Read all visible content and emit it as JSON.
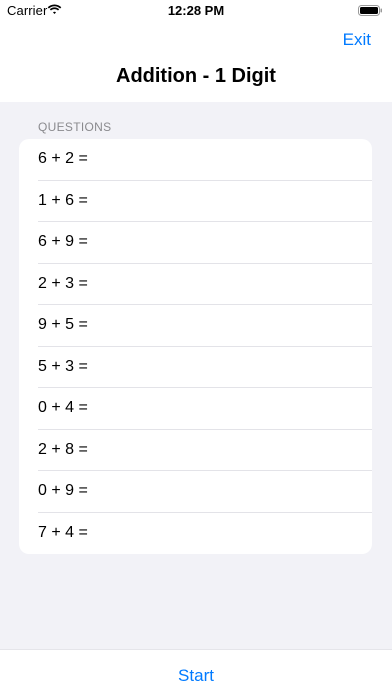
{
  "status_bar": {
    "carrier": "Carrier",
    "time": "12:28 PM",
    "wifi_icon": "wifi-icon",
    "battery_icon": "battery-icon"
  },
  "nav": {
    "exit_label": "Exit",
    "title": "Addition - 1 Digit"
  },
  "section": {
    "header": "QUESTIONS"
  },
  "questions": [
    "6 + 2 =",
    "1 + 6 =",
    "6 + 9 =",
    "2 + 3 =",
    "9 + 5 =",
    "5 + 3 =",
    "0 + 4 =",
    "2 + 8 =",
    "0 + 9 =",
    "7 + 4 ="
  ],
  "toolbar": {
    "start_label": "Start"
  },
  "colors": {
    "accent": "#007aff",
    "background": "#f2f2f7",
    "card": "#ffffff",
    "section_header": "#8a8a8e"
  }
}
